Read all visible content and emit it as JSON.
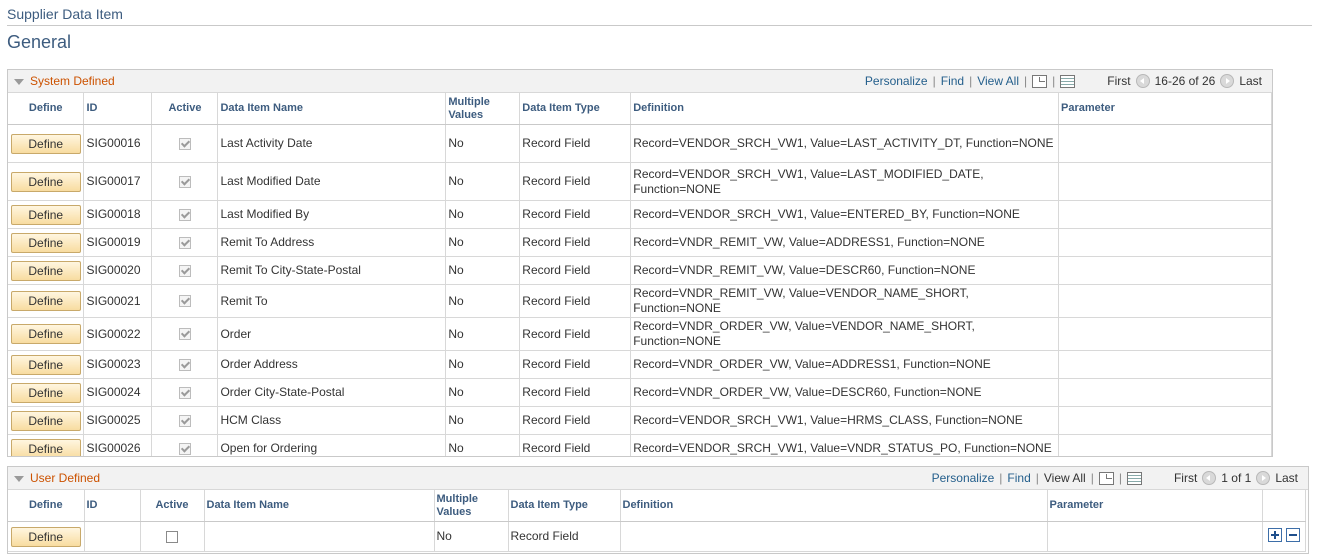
{
  "page": {
    "breadcrumb": "Supplier Data Item",
    "title": "General"
  },
  "toolbar": {
    "personalize": "Personalize",
    "find": "Find",
    "view_all": "View All",
    "first": "First",
    "last": "Last"
  },
  "columns": {
    "define": "Define",
    "id": "ID",
    "active": "Active",
    "name": "Data Item Name",
    "multiple": "Multiple Values",
    "type": "Data Item Type",
    "definition": "Definition",
    "parameter": "Parameter"
  },
  "system_defined": {
    "title": "System Defined",
    "range": "16-26 of 26",
    "rows": [
      {
        "define": "Define",
        "id": "SIG00016",
        "active": true,
        "name": "Last Activity Date",
        "multiple": "No",
        "type": "Record Field",
        "definition": "Record=VENDOR_SRCH_VW1, Value=LAST_ACTIVITY_DT, Function=NONE",
        "parameter": ""
      },
      {
        "define": "Define",
        "id": "SIG00017",
        "active": true,
        "name": "Last Modified Date",
        "multiple": "No",
        "type": "Record Field",
        "definition": "Record=VENDOR_SRCH_VW1, Value=LAST_MODIFIED_DATE, Function=NONE",
        "parameter": ""
      },
      {
        "define": "Define",
        "id": "SIG00018",
        "active": true,
        "name": "Last Modified By",
        "multiple": "No",
        "type": "Record Field",
        "definition": "Record=VENDOR_SRCH_VW1, Value=ENTERED_BY, Function=NONE",
        "parameter": ""
      },
      {
        "define": "Define",
        "id": "SIG00019",
        "active": true,
        "name": "Remit To Address",
        "multiple": "No",
        "type": "Record Field",
        "definition": "Record=VNDR_REMIT_VW, Value=ADDRESS1, Function=NONE",
        "parameter": ""
      },
      {
        "define": "Define",
        "id": "SIG00020",
        "active": true,
        "name": "Remit To City-State-Postal",
        "multiple": "No",
        "type": "Record Field",
        "definition": "Record=VNDR_REMIT_VW, Value=DESCR60, Function=NONE",
        "parameter": ""
      },
      {
        "define": "Define",
        "id": "SIG00021",
        "active": true,
        "name": "Remit To",
        "multiple": "No",
        "type": "Record Field",
        "definition": "Record=VNDR_REMIT_VW, Value=VENDOR_NAME_SHORT, Function=NONE",
        "parameter": ""
      },
      {
        "define": "Define",
        "id": "SIG00022",
        "active": true,
        "name": "Order",
        "multiple": "No",
        "type": "Record Field",
        "definition": "Record=VNDR_ORDER_VW, Value=VENDOR_NAME_SHORT, Function=NONE",
        "parameter": ""
      },
      {
        "define": "Define",
        "id": "SIG00023",
        "active": true,
        "name": "Order Address",
        "multiple": "No",
        "type": "Record Field",
        "definition": "Record=VNDR_ORDER_VW, Value=ADDRESS1, Function=NONE",
        "parameter": ""
      },
      {
        "define": "Define",
        "id": "SIG00024",
        "active": true,
        "name": "Order City-State-Postal",
        "multiple": "No",
        "type": "Record Field",
        "definition": "Record=VNDR_ORDER_VW, Value=DESCR60, Function=NONE",
        "parameter": ""
      },
      {
        "define": "Define",
        "id": "SIG00025",
        "active": true,
        "name": "HCM Class",
        "multiple": "No",
        "type": "Record Field",
        "definition": "Record=VENDOR_SRCH_VW1, Value=HRMS_CLASS, Function=NONE",
        "parameter": ""
      },
      {
        "define": "Define",
        "id": "SIG00026",
        "active": true,
        "name": "Open for Ordering",
        "multiple": "No",
        "type": "Record Field",
        "definition": "Record=VENDOR_SRCH_VW1, Value=VNDR_STATUS_PO, Function=NONE",
        "parameter": ""
      }
    ]
  },
  "user_defined": {
    "title": "User Defined",
    "range": "1 of 1",
    "rows": [
      {
        "define": "Define",
        "id": "",
        "active": false,
        "name": "",
        "multiple": "No",
        "type": "Record Field",
        "definition": "",
        "parameter": ""
      }
    ]
  },
  "icons": [
    "collapse-triangle-icon",
    "zoom-grid-icon",
    "download-icon",
    "prev-icon",
    "next-icon",
    "add-row-icon",
    "delete-row-icon"
  ]
}
